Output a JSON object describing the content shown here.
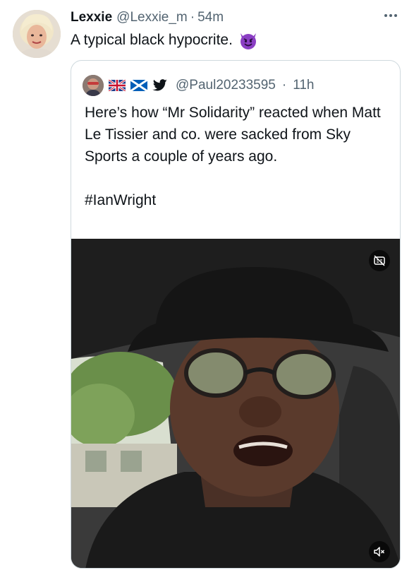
{
  "tweet": {
    "author_name": "Lexxie",
    "author_handle": "@Lexxie_m",
    "separator": "·",
    "time": "54m",
    "text": "A typical black hypocrite.",
    "emoji": "smiling-face-with-horns-emoji"
  },
  "quoted_tweet": {
    "flags": [
      "uk-flag",
      "scotland-flag"
    ],
    "bird_icon": "twitter-bird-icon",
    "handle": "@Paul20233595",
    "separator": "·",
    "time": "11h",
    "text": "Here’s how “Mr Solidarity” reacted when Matt Le Tissier and co. were sacked from Sky Sports a couple of years ago.",
    "hashtag": "#IanWright"
  },
  "media": {
    "type": "video",
    "description_icon_top": "captions-off-icon",
    "description_icon_bottom": "muted-speaker-icon"
  },
  "colors": {
    "text_primary": "#0f1419",
    "text_secondary": "#536471",
    "border": "#cfd9de",
    "emoji_purple": "#8b3fc4"
  }
}
